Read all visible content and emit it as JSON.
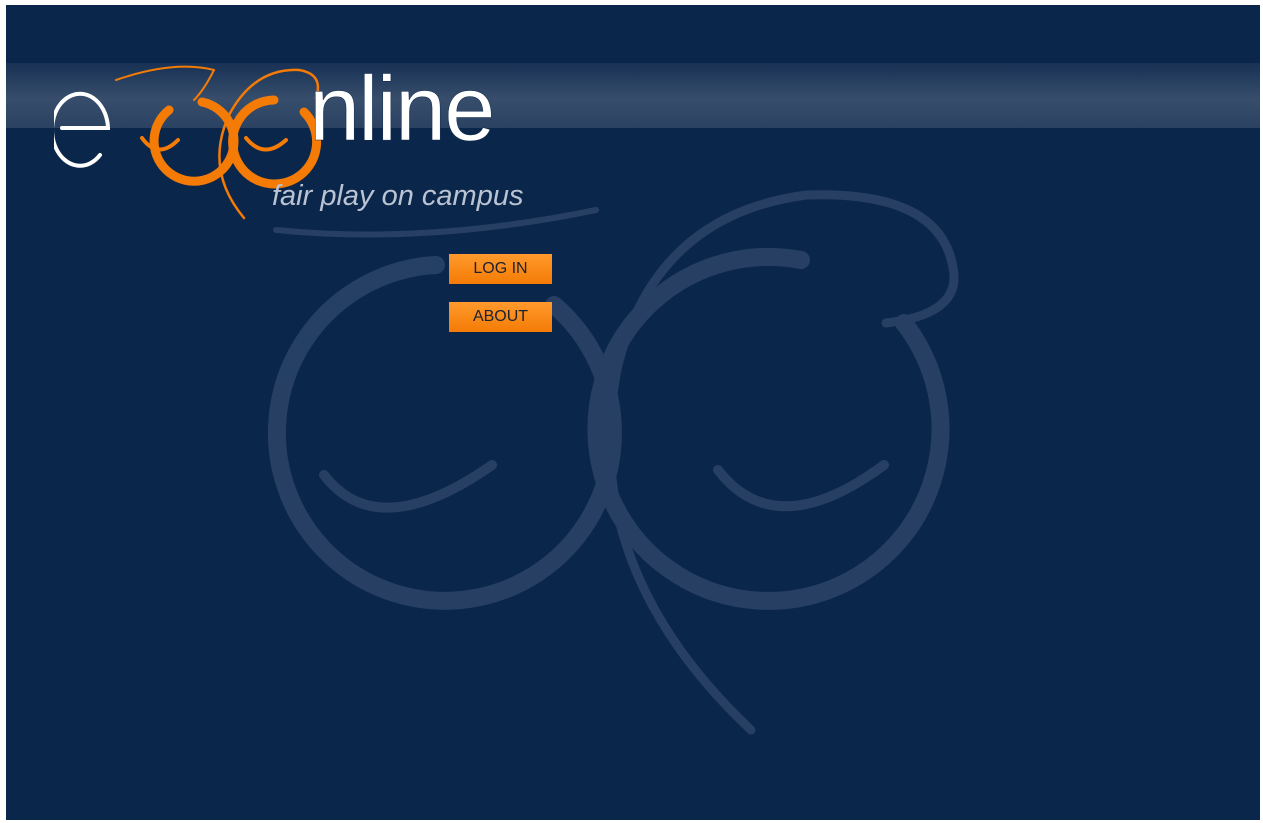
{
  "brand": {
    "wordmark_prefix": "e",
    "wordmark_suffix": "nline",
    "tagline": "fair play on campus"
  },
  "nav": {
    "login_label": "LOG IN",
    "about_label": "ABOUT"
  },
  "colors": {
    "background": "#0b264b",
    "accent_orange": "#f47b06",
    "logo_white": "#ffffff",
    "tagline_gray": "#b9c3d2"
  }
}
